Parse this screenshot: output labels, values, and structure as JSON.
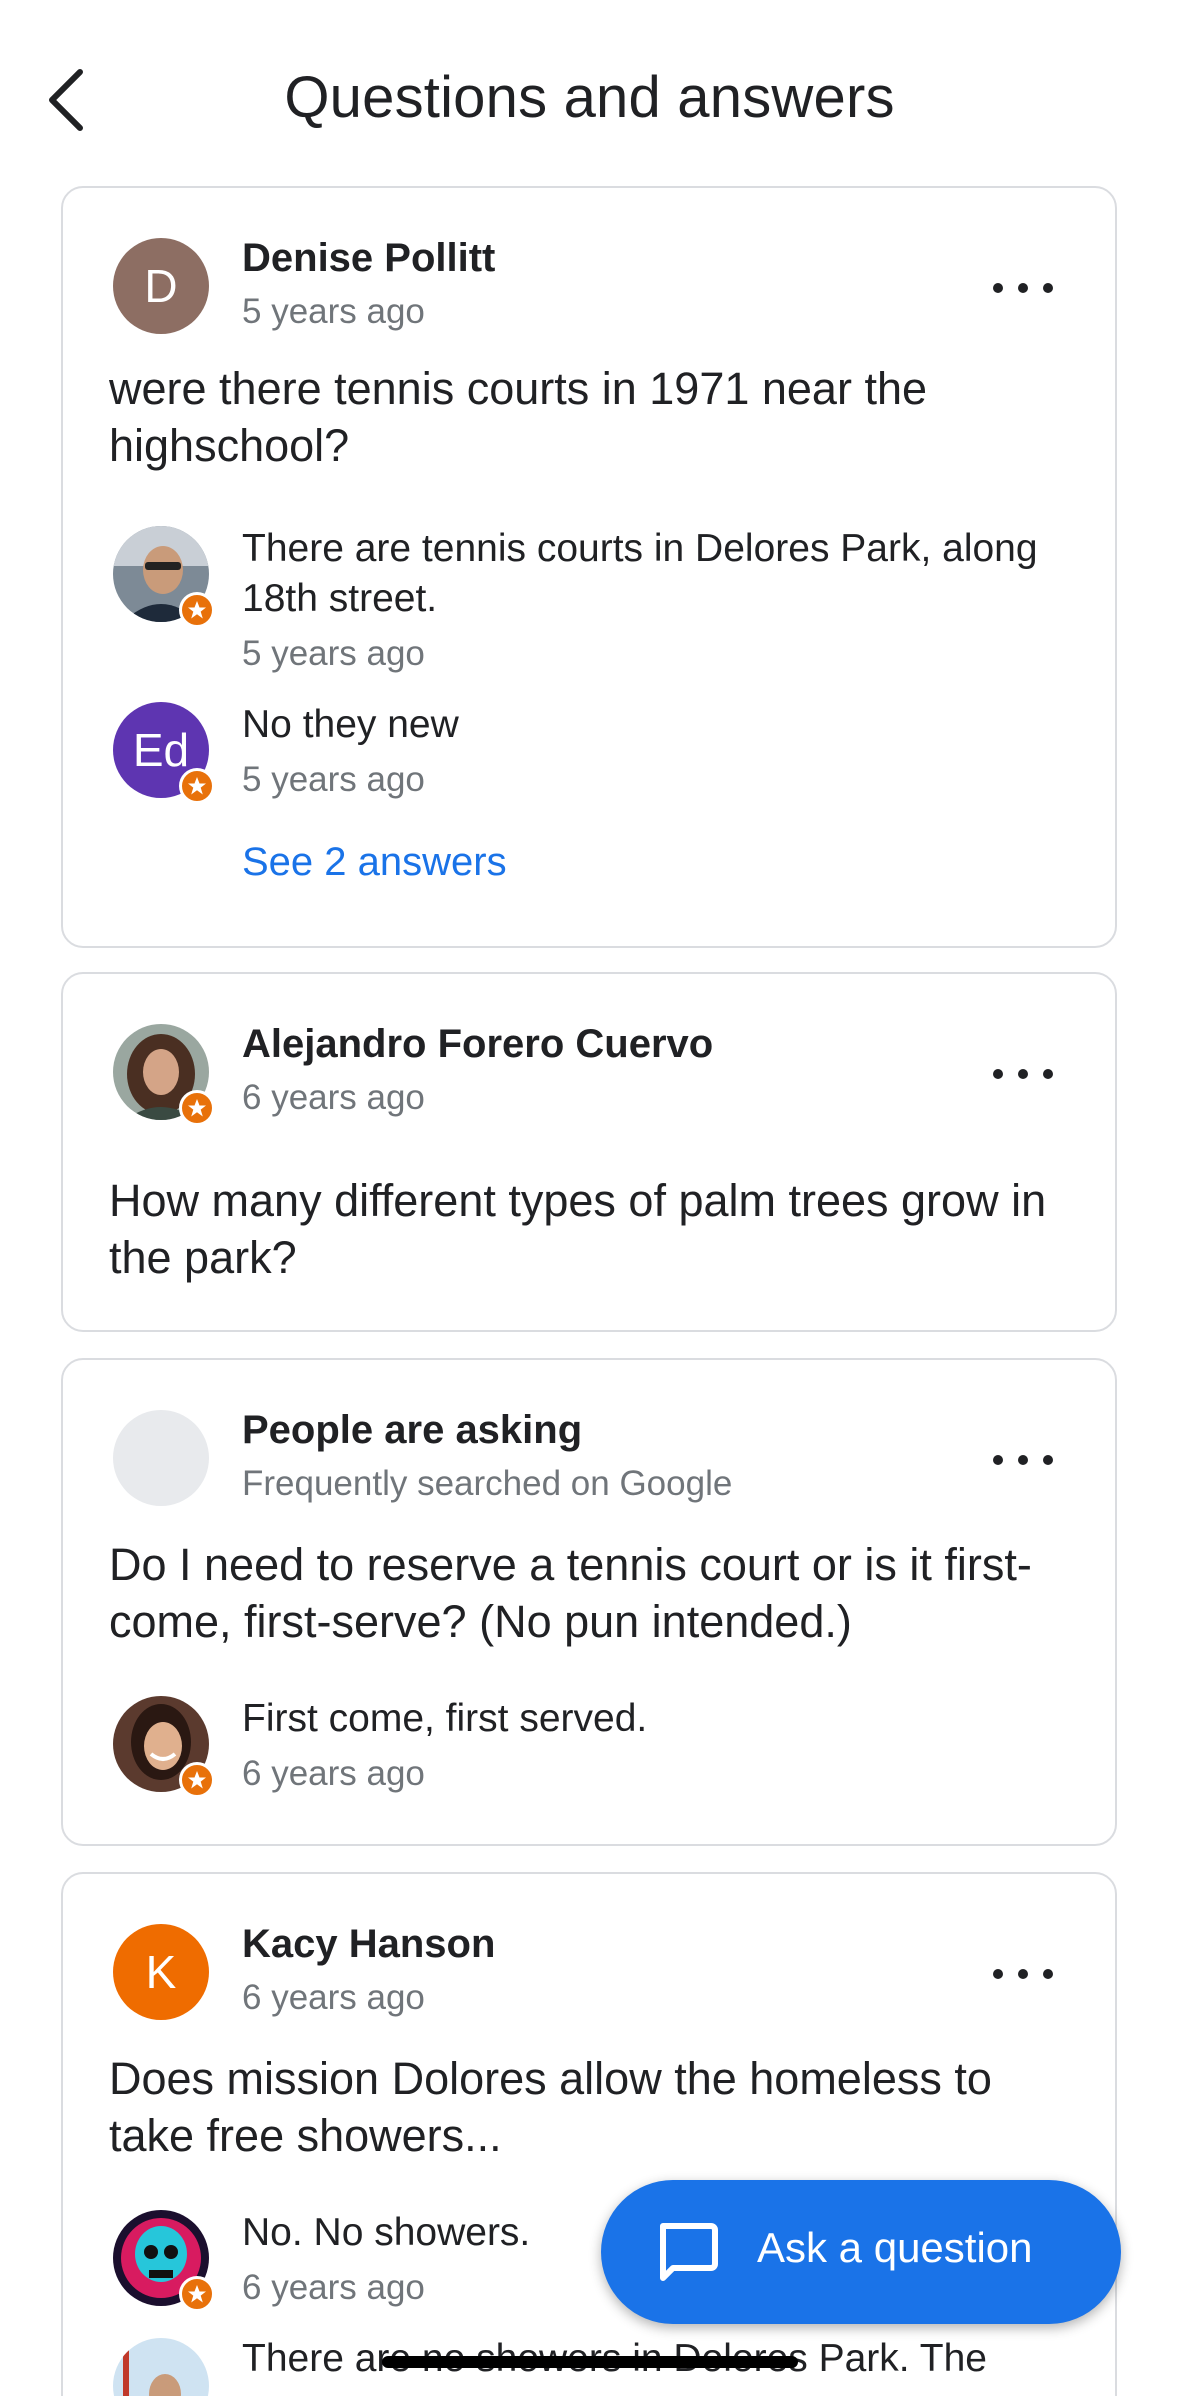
{
  "header": {
    "title": "Questions and answers",
    "back_icon": "chevron-left-icon"
  },
  "cards": [
    {
      "author": {
        "name": "Denise Pollitt",
        "time": "5 years ago",
        "initial": "D",
        "avatar_color": "#8d6e63"
      },
      "question": "were there tennis courts in 1971 near the highschool?",
      "answers": [
        {
          "text": "There are tennis courts in Delores Park, along 18th street.",
          "time": "5 years ago",
          "avatar": "photo-man-glasses"
        },
        {
          "text": "No they new",
          "time": "5 years ago",
          "initial": "Ed",
          "avatar_color": "#5e35b1"
        }
      ],
      "see_more": "See 2 answers"
    },
    {
      "author": {
        "name": "Alejandro Forero Cuervo",
        "time": "6 years ago",
        "avatar": "photo-person-curly-hair"
      },
      "question": "How many different types of palm trees grow in the park?"
    },
    {
      "author": {
        "name": "People are asking",
        "time": "Frequently searched on Google",
        "avatar_color": "#e8eaed"
      },
      "question": "Do I need to reserve a tennis court or is it first-come, first-serve? (No pun intended.)",
      "answers": [
        {
          "text": "First come, first served.",
          "time": "6 years ago",
          "avatar": "photo-woman-smiling"
        }
      ]
    },
    {
      "author": {
        "name": "Kacy Hanson",
        "time": "6 years ago",
        "initial": "K",
        "avatar_color": "#ef6c00"
      },
      "question": "Does mission Dolores allow the homeless to take free showers...",
      "answers": [
        {
          "text": "No. No showers.",
          "time": "6 years ago",
          "avatar": "skull-artwork"
        },
        {
          "text": "There are no showers in Dolores Park. The",
          "avatar": "photo-man-bridge"
        }
      ]
    }
  ],
  "fab": {
    "label": "Ask a question",
    "icon": "chat-bubble-icon"
  },
  "colors": {
    "accent": "#1a73e8",
    "badge": "#e8710a",
    "muted": "#70757a"
  }
}
